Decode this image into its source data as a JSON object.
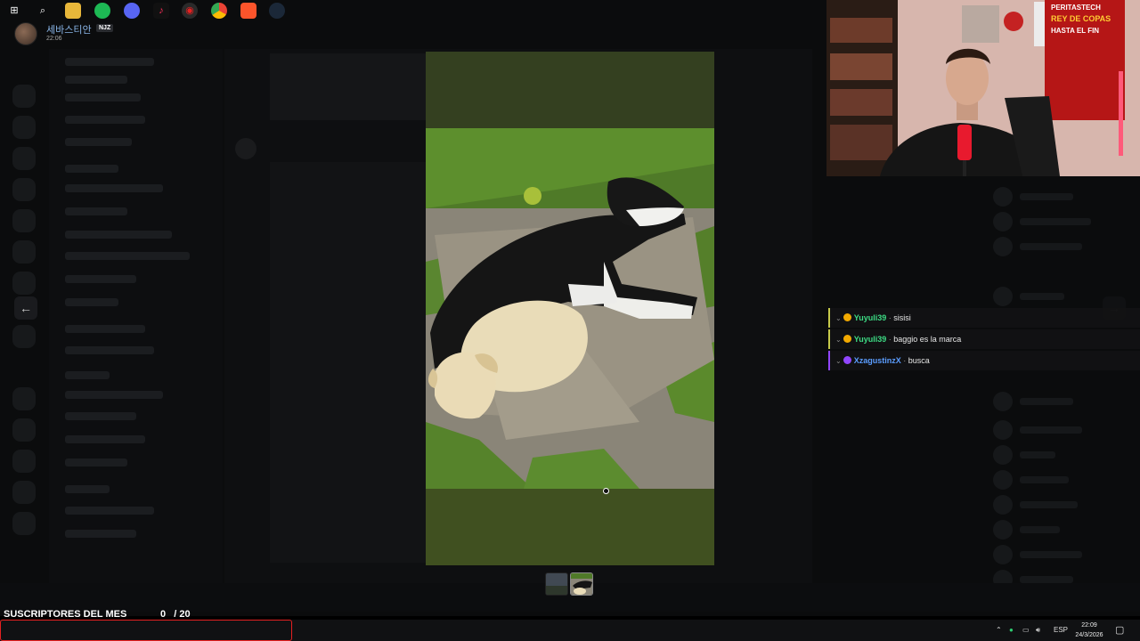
{
  "uploader": {
    "name": "세바스티안",
    "tag": "NJZ",
    "time": "22:06"
  },
  "viewer": {
    "prev_label": "←",
    "next_label": "→"
  },
  "chat": [
    {
      "user": "Yuyuli39",
      "sep": " · ",
      "message": "sisisi",
      "color": "#3ddc84",
      "badge_color": "#f2a900",
      "border": "yellow"
    },
    {
      "user": "Yuyuli39",
      "sep": " · ",
      "message": "baggio es la marca",
      "color": "#3ddc84",
      "badge_color": "#f2a900",
      "border": "yellow"
    },
    {
      "user": "XzagustinzX",
      "sep": " · ",
      "message": "busca",
      "color": "#5b9dff",
      "badge_color": "#9146ff",
      "border": "purple"
    }
  ],
  "subgoal": {
    "label": "SUSCRIPTORES DEL MES",
    "current": "0",
    "total": "/ 20"
  },
  "webcam": {
    "banner_brand": "PERITASTECH",
    "banner_title": "REY DE COPAS",
    "banner_sub": "HASTA EL FIN"
  },
  "taskbar": {
    "lang": "ESP",
    "clock_time": "22:09",
    "clock_date": "24/3/2026"
  },
  "colors": {
    "viewer_top": "#344020",
    "viewer_bottom": "#405020",
    "taskbar_border": "#e52020"
  }
}
